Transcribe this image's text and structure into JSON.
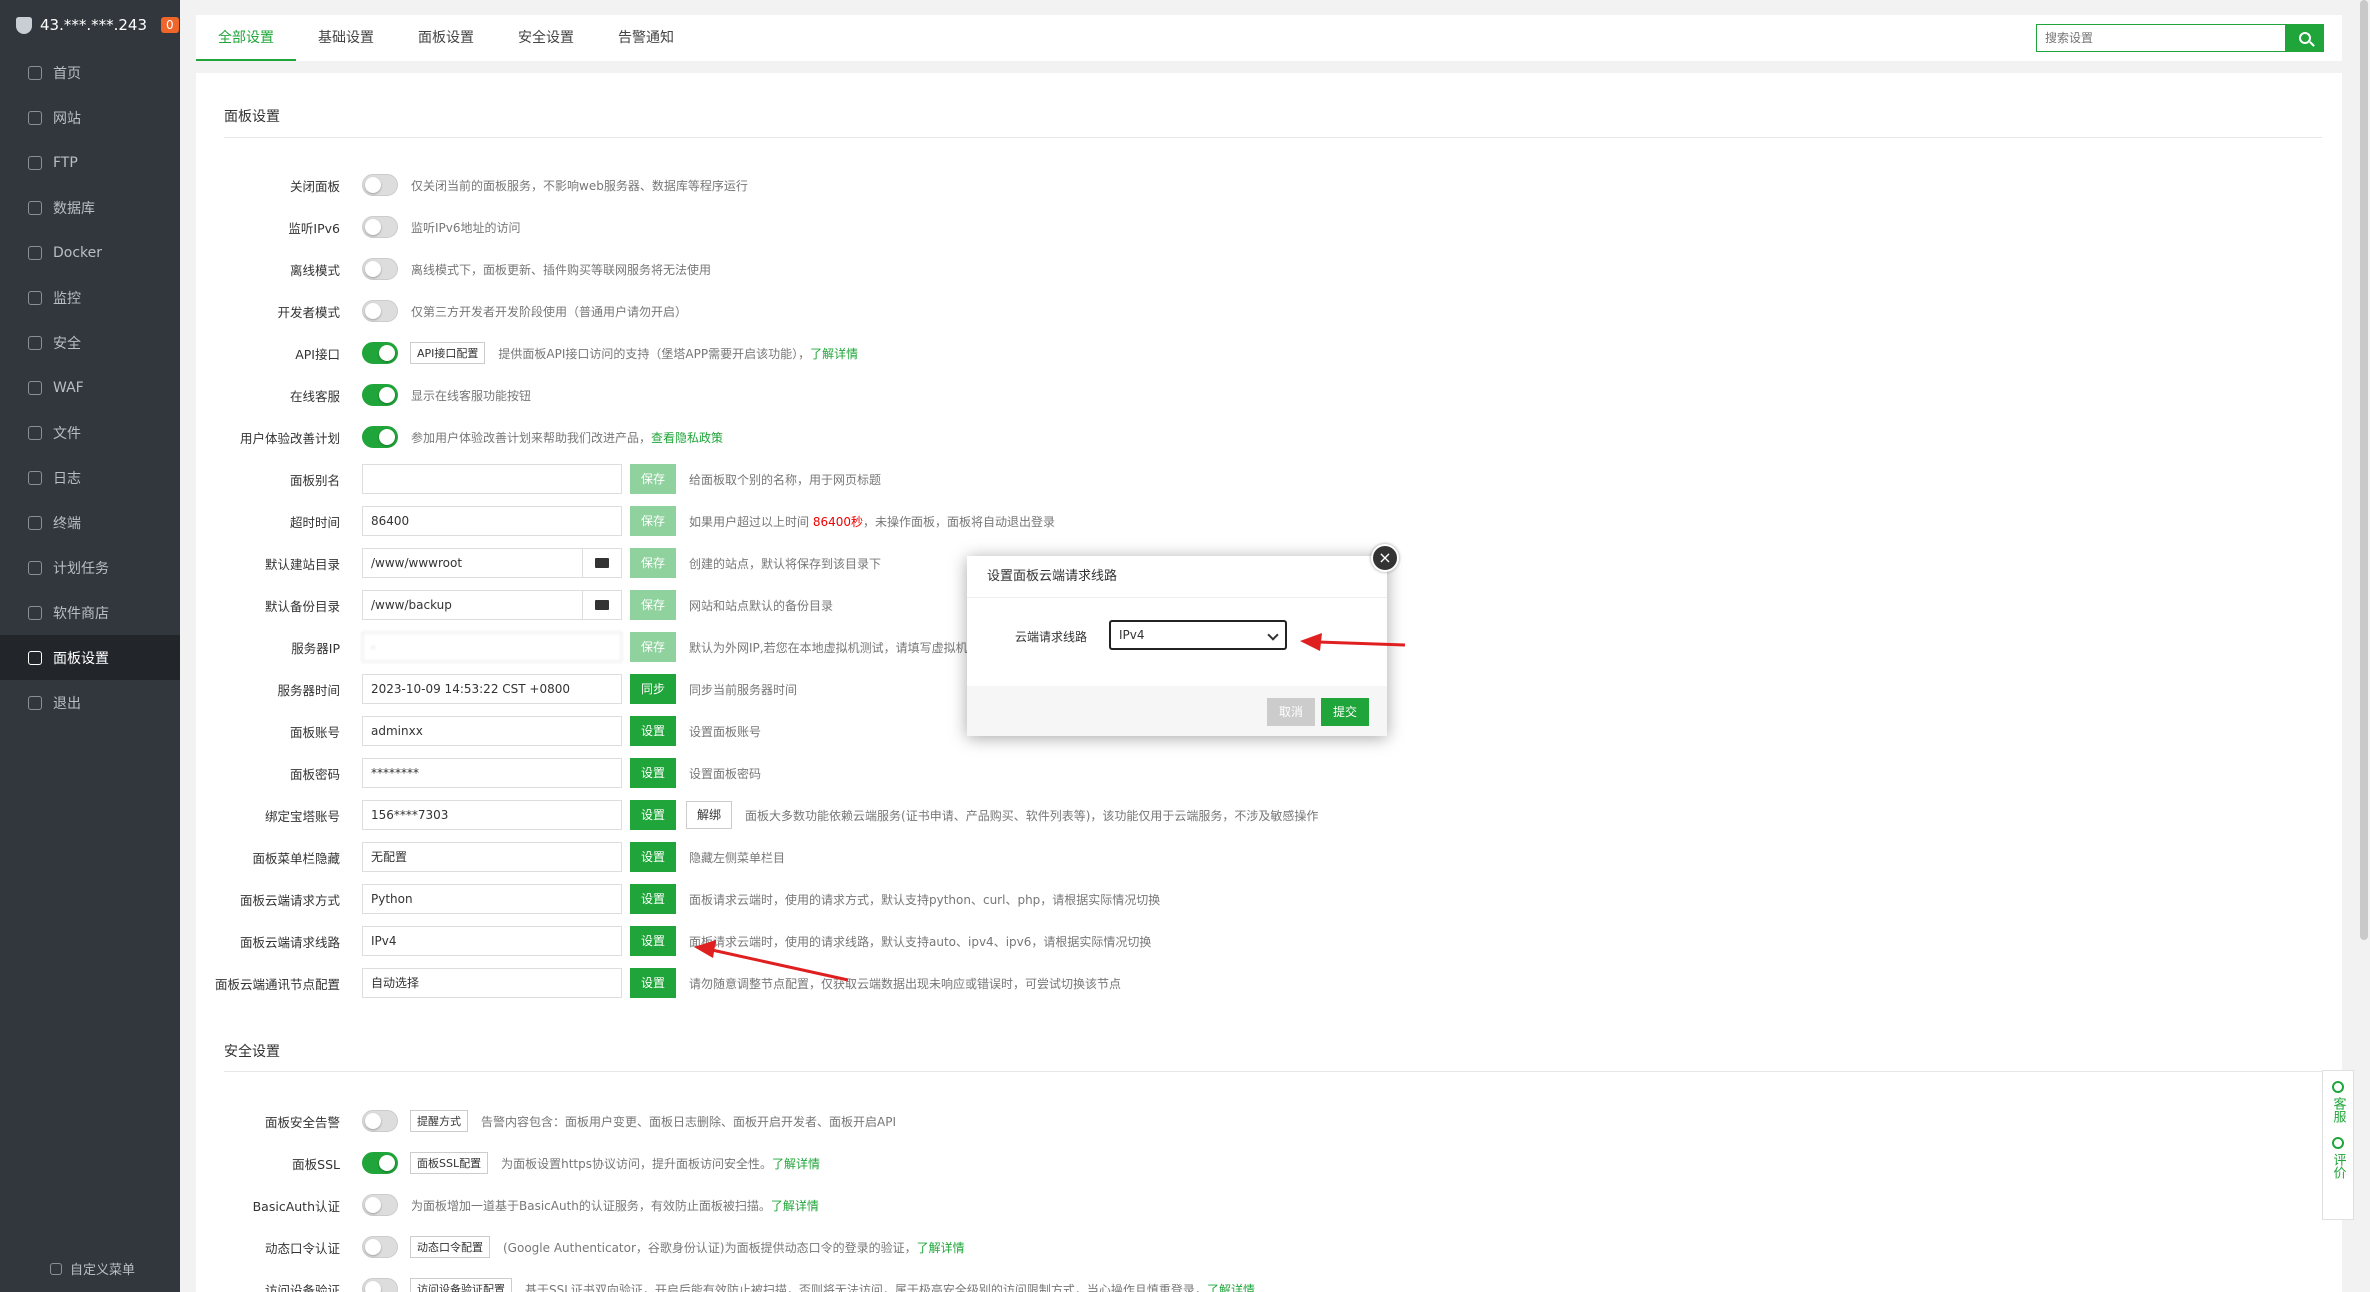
{
  "sidebar": {
    "ip": "43.***.***.243",
    "badge": "0",
    "items": [
      {
        "label": "首页",
        "icon": "home-icon"
      },
      {
        "label": "网站",
        "icon": "globe-icon"
      },
      {
        "label": "FTP",
        "icon": "ftp-icon"
      },
      {
        "label": "数据库",
        "icon": "database-icon"
      },
      {
        "label": "Docker",
        "icon": "docker-icon"
      },
      {
        "label": "监控",
        "icon": "monitor-icon"
      },
      {
        "label": "安全",
        "icon": "shield-icon"
      },
      {
        "label": "WAF",
        "icon": "waf-icon"
      },
      {
        "label": "文件",
        "icon": "folder-icon"
      },
      {
        "label": "日志",
        "icon": "log-icon"
      },
      {
        "label": "终端",
        "icon": "terminal-icon"
      },
      {
        "label": "计划任务",
        "icon": "calendar-icon"
      },
      {
        "label": "软件商店",
        "icon": "store-icon"
      },
      {
        "label": "面板设置",
        "icon": "gear-icon"
      },
      {
        "label": "退出",
        "icon": "logout-icon"
      }
    ],
    "custom_menu": "自定义菜单"
  },
  "tabs": [
    "全部设置",
    "基础设置",
    "面板设置",
    "安全设置",
    "告警通知"
  ],
  "search": {
    "placeholder": "搜索设置"
  },
  "panel_section": "面板设置",
  "security_section": "安全设置",
  "toggles": [
    {
      "label": "关闭面板",
      "on": false,
      "desc": "仅关闭当前的面板服务，不影响web服务器、数据库等程序运行"
    },
    {
      "label": "监听IPv6",
      "on": false,
      "desc": "监听IPv6地址的访问"
    },
    {
      "label": "离线模式",
      "on": false,
      "desc": "离线模式下，面板更新、插件购买等联网服务将无法使用"
    },
    {
      "label": "开发者模式",
      "on": false,
      "desc": "仅第三方开发者开发阶段使用（普通用户请勿开启）"
    },
    {
      "label": "API接口",
      "on": true,
      "btn": "API接口配置",
      "desc": "提供面板API接口访问的支持（堡塔APP需要开启该功能），",
      "link": "了解详情"
    },
    {
      "label": "在线客服",
      "on": true,
      "desc": "显示在线客服功能按钮"
    },
    {
      "label": "用户体验改善计划",
      "on": true,
      "desc": "参加用户体验改善计划来帮助我们改进产品，",
      "link": "查看隐私政策"
    }
  ],
  "fields": {
    "alias": {
      "label": "面板别名",
      "value": "",
      "btn": "保存",
      "desc": "给面板取个别的名称，用于网页标题"
    },
    "timeout": {
      "label": "超时时间",
      "value": "86400",
      "btn": "保存",
      "desc1": "如果用户超过以上时间 ",
      "red": "86400秒",
      "desc2": "，未操作面板，面板将自动退出登录"
    },
    "site_dir": {
      "label": "默认建站目录",
      "value": "/www/wwwroot",
      "btn": "保存",
      "desc": "创建的站点，默认将保存到该目录下"
    },
    "backup_dir": {
      "label": "默认备份目录",
      "value": "/www/backup",
      "btn": "保存",
      "desc": "网站和站点默认的备份目录"
    },
    "server_ip": {
      "label": "服务器IP",
      "value": "-",
      "btn": "保存",
      "desc": "默认为外网IP,若您在本地虚拟机测试，请填写虚拟机内"
    },
    "server_time": {
      "label": "服务器时间",
      "value": "2023-10-09 14:53:22 CST +0800",
      "btn": "同步",
      "desc": "同步当前服务器时间"
    },
    "account": {
      "label": "面板账号",
      "value": "adminxx",
      "btn": "设置",
      "desc": "设置面板账号"
    },
    "password": {
      "label": "面板密码",
      "value": "********",
      "btn": "设置",
      "desc": "设置面板密码"
    },
    "bt_account": {
      "label": "绑定宝塔账号",
      "value": "156****7303",
      "btn": "设置",
      "btn2": "解绑",
      "desc": "面板大多数功能依赖云端服务(证书申请、产品购买、软件列表等)，该功能仅用于云端服务，不涉及敏感操作"
    },
    "menu_hide": {
      "label": "面板菜单栏隐藏",
      "value": "无配置",
      "btn": "设置",
      "desc": "隐藏左侧菜单栏目"
    },
    "req_method": {
      "label": "面板云端请求方式",
      "value": "Python",
      "btn": "设置",
      "desc": "面板请求云端时，使用的请求方式，默认支持python、curl、php，请根据实际情况切换"
    },
    "req_line": {
      "label": "面板云端请求线路",
      "value": "IPv4",
      "btn": "设置",
      "desc": "面板请求云端时，使用的请求线路，默认支持auto、ipv4、ipv6，请根据实际情况切换"
    },
    "node": {
      "label": "面板云端通讯节点配置",
      "value": "自动选择",
      "btn": "设置",
      "desc": "请勿随意调整节点配置，仅获取云端数据出现未响应或错误时，可尝试切换该节点"
    }
  },
  "security": [
    {
      "label": "面板安全告警",
      "on": false,
      "btn": "提醒方式",
      "desc": "告警内容包含：面板用户变更、面板日志删除、面板开启开发者、面板开启API"
    },
    {
      "label": "面板SSL",
      "on": true,
      "btn": "面板SSL配置",
      "desc": "为面板设置https协议访问，提升面板访问安全性。",
      "link": "了解详情"
    },
    {
      "label": "BasicAuth认证",
      "on": false,
      "desc": "为面板增加一道基于BasicAuth的认证服务，有效防止面板被扫描。",
      "link": "了解详情"
    },
    {
      "label": "动态口令认证",
      "on": false,
      "btn": "动态口令配置",
      "desc": "(Google Authenticator，谷歌身份认证)为面板提供动态口令的登录的验证，",
      "link": "了解详情"
    },
    {
      "label": "访问设备验证",
      "on": false,
      "btn": "访问设备验证配置",
      "desc": "基于SSL证书双向验证，开启后能有效防止被扫描，否则将无法访问，属于极高安全级别的访问限制方式，当心操作且慎重登录，",
      "link": "了解详情"
    }
  ],
  "modal": {
    "title": "设置面板云端请求线路",
    "label": "云端请求线路",
    "value": "IPv4",
    "cancel": "取消",
    "submit": "提交"
  },
  "float": {
    "service": "客服",
    "review": "评价"
  },
  "colors": {
    "accent": "#20a53a",
    "sidebar": "#32373e"
  }
}
